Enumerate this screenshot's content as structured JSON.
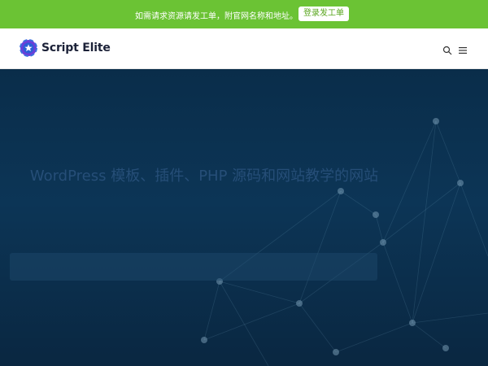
{
  "topbar": {
    "notice": "如需请求资源请发工单，附官网名称和地址。",
    "notice_icon": "",
    "button_label": "登录发工单",
    "close_icon": "",
    "background": "#6bc334"
  },
  "header": {
    "logo_text": "Script Elite",
    "search_icon": "",
    "menu_icon": ""
  },
  "hero": {
    "title": "WordPress 模板、插件、PHP 源码和网站教学的网站",
    "search_placeholder": ""
  }
}
